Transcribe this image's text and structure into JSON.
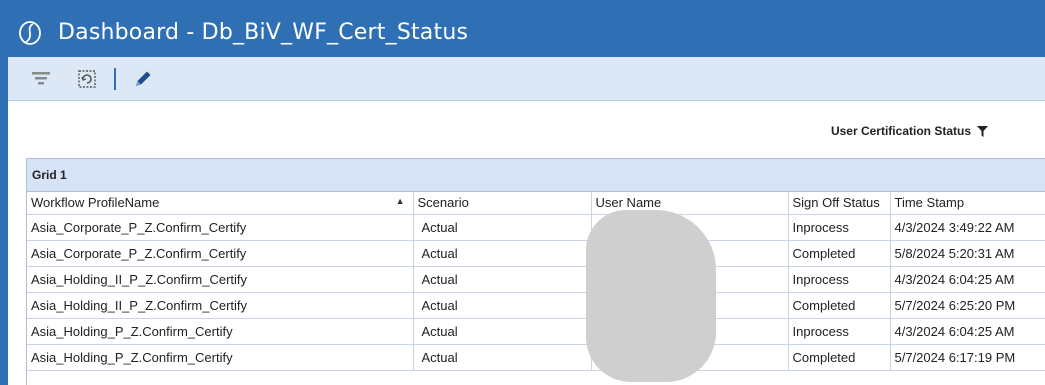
{
  "window": {
    "title": "Dashboard - Db_BiV_WF_Cert_Status"
  },
  "toolbar": {
    "items": [
      {
        "icon": "filter-icon"
      },
      {
        "icon": "refresh-icon"
      },
      {
        "icon": "edit-pencil-icon"
      }
    ]
  },
  "status_label": "User Certification Status",
  "grid": {
    "title": "Grid 1",
    "columns": [
      "Workflow ProfileName",
      "Scenario",
      "User Name",
      "Sign Off Status",
      "Time Stamp"
    ],
    "sorted_column": "Workflow ProfileName",
    "sort_direction": "ascending",
    "rows": [
      [
        "Asia_Corporate_P_Z.Confirm_Certify",
        "Actual",
        "",
        "Inprocess",
        "4/3/2024 3:49:22 AM"
      ],
      [
        "Asia_Corporate_P_Z.Confirm_Certify",
        "Actual",
        "",
        "Completed",
        "5/8/2024 5:20:31 AM"
      ],
      [
        "Asia_Holding_II_P_Z.Confirm_Certify",
        "Actual",
        "",
        "Inprocess",
        "4/3/2024 6:04:25 AM"
      ],
      [
        "Asia_Holding_II_P_Z.Confirm_Certify",
        "Actual",
        "",
        "Completed",
        "5/7/2024 6:25:20 PM"
      ],
      [
        "Asia_Holding_P_Z.Confirm_Certify",
        "Actual",
        "",
        "Inprocess",
        "4/3/2024 6:04:25 AM"
      ],
      [
        "Asia_Holding_P_Z.Confirm_Certify",
        "Actual",
        "",
        "Completed",
        "5/7/2024 6:17:19 PM"
      ]
    ]
  },
  "colors": {
    "titlebar": "#2f6fb3",
    "toolbar": "#dde8f7",
    "grid_header": "#d6e2f5"
  }
}
